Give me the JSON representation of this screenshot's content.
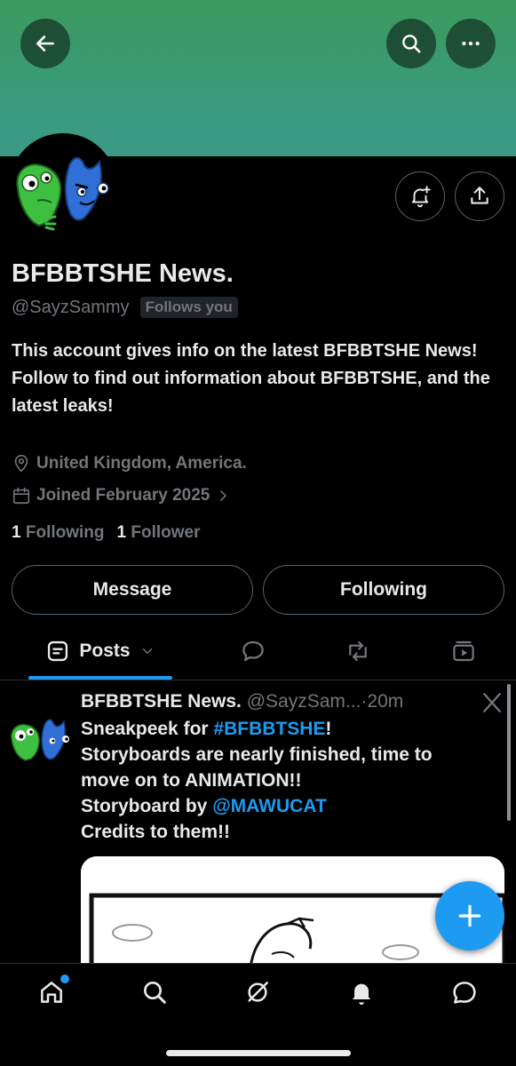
{
  "header": {
    "back_icon": "arrow-left-icon",
    "search_icon": "search-icon",
    "more_icon": "more-horizontal-icon"
  },
  "profile": {
    "name": "BFBBTSHE News.",
    "handle": "@SayzSammy",
    "follows_you": "Follows you",
    "bio_lines": [
      "This account gives info on the latest BFBBTSHE News!",
      "Follow to find out information about BFBBTSHE, and the latest leaks!"
    ],
    "location": "United Kingdom, America.",
    "joined": "Joined February 2025",
    "following_count": "1",
    "following_label": "Following",
    "followers_count": "1",
    "followers_label": "Follower",
    "message_button": "Message",
    "following_button": "Following"
  },
  "tabs": {
    "posts_label": "Posts"
  },
  "post": {
    "name": "BFBBTSHE News.",
    "handle": "@SayzSam...",
    "separator": "·",
    "time": "20m",
    "line1_prefix": "Sneakpeek for ",
    "line1_hashtag": "#BFBBTSHE",
    "line1_suffix": "!",
    "line2": "Storyboards are nearly finished, time to",
    "line3": "move on to ANIMATION!!",
    "line4_prefix": "Storyboard by ",
    "line4_mention": "@MAWUCAT",
    "line5": "Credits to them!!"
  },
  "colors": {
    "accent": "#1d9bf0",
    "banner_top": "#3c9b5d",
    "banner_bottom": "#3a9a88",
    "muted": "#71767b"
  }
}
